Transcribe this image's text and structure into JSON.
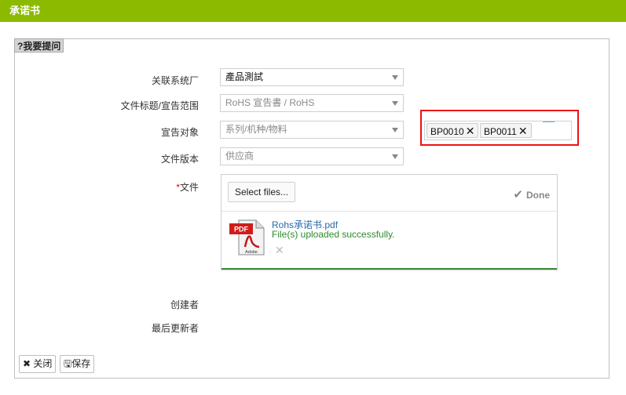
{
  "window": {
    "title": "承诺书"
  },
  "help": {
    "label": "?我要提问"
  },
  "form": {
    "factory": {
      "label": "关联系统厂",
      "value": "產品測試"
    },
    "doc_title": {
      "label": "文件标题/宣告范围",
      "value": "RoHS 宣告書 / RoHS"
    },
    "target": {
      "label": "宣告对象",
      "value": "系列/机种/物料",
      "tags": [
        "BP0010",
        "BP0011"
      ]
    },
    "version": {
      "label": "文件版本",
      "value": "供应商"
    },
    "file": {
      "label": "文件",
      "required_mark": "*",
      "select_label": "Select files...",
      "done_label": "Done",
      "file_name": "Rohs承诺书.pdf",
      "status": "File(s) uploaded successfully.",
      "icon_text": "PDF",
      "icon_brand": "Adobe",
      "progress": 1.0
    },
    "creator": {
      "label": "创建者"
    },
    "updater": {
      "label": "最后更新者"
    }
  },
  "buttons": {
    "close": "关闭",
    "save": "保存"
  },
  "colors": {
    "header": "#8cba00",
    "highlight": "#e11111",
    "link": "#2a6aa8",
    "success": "#2b8a2b"
  }
}
